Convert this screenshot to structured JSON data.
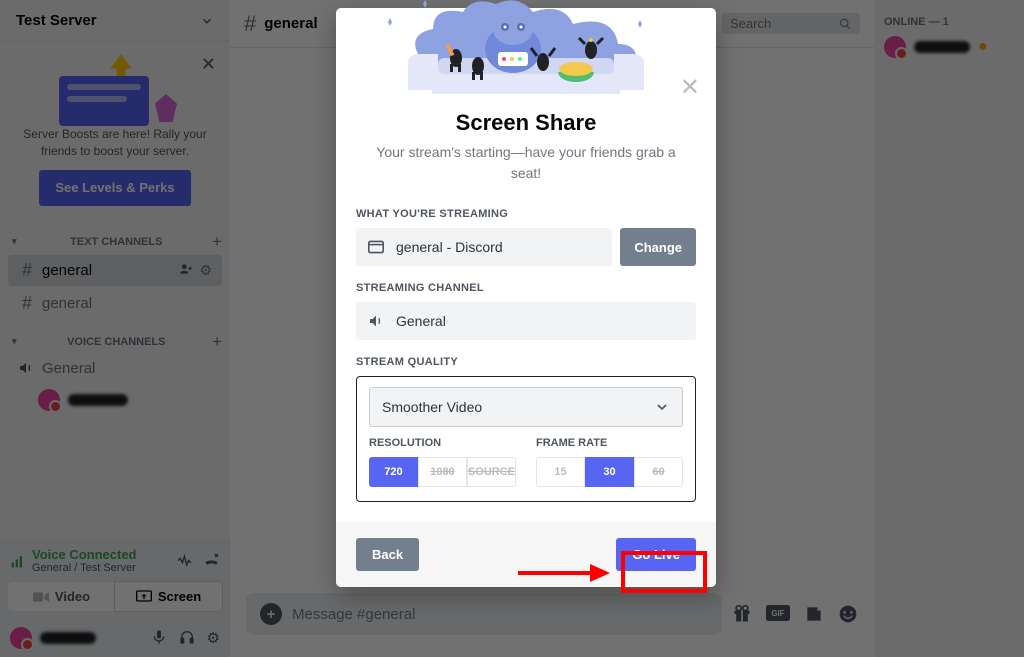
{
  "sidebar": {
    "server_name": "Test Server",
    "promo": {
      "text": "Server Boosts are here! Rally your friends to boost your server.",
      "button": "See Levels & Perks"
    },
    "text_label": "TEXT CHANNELS",
    "voice_label": "VOICE CHANNELS",
    "channels": {
      "general1": "general",
      "general2": "general",
      "voice_general": "General"
    },
    "voice_status": {
      "title": "Voice Connected",
      "sub": "General / Test Server"
    },
    "buttons": {
      "video": "Video",
      "screen": "Screen"
    }
  },
  "header": {
    "channel": "general",
    "search_placeholder": "Search"
  },
  "members": {
    "header": "ONLINE — 1"
  },
  "input": {
    "placeholder": "Message #general"
  },
  "modal": {
    "title": "Screen Share",
    "subtitle": "Your stream's starting—have your friends grab a seat!",
    "label_what": "WHAT YOU'RE STREAMING",
    "streaming_value": "general - Discord",
    "change": "Change",
    "label_channel": "STREAMING CHANNEL",
    "channel_value": "General",
    "label_quality": "STREAM QUALITY",
    "quality_select": "Smoother Video",
    "resolution_label": "RESOLUTION",
    "framerate_label": "FRAME RATE",
    "res": {
      "r720": "720",
      "r1080": "1080",
      "src": "SOURCE"
    },
    "fps": {
      "f15": "15",
      "f30": "30",
      "f60": "60"
    },
    "back": "Back",
    "go_live": "Go Live"
  }
}
